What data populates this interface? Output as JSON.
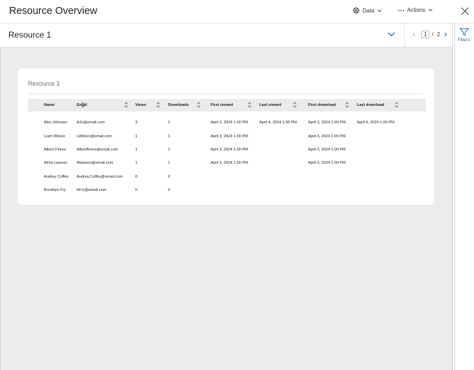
{
  "header": {
    "title": "Resource Overview",
    "data_label": "Data",
    "actions_label": "Actions"
  },
  "subbar": {
    "resource_name": "Resource 1",
    "pager": {
      "current": "1",
      "separator": "/",
      "total": "2"
    }
  },
  "rail": {
    "filters_label": "Filters"
  },
  "card": {
    "title": "Resource 1"
  },
  "table": {
    "columns": [
      "Name",
      "Email",
      "Views",
      "Downloads",
      "First viewed",
      "Last viewed",
      "First download",
      "Last download"
    ],
    "rows": [
      [
        "Alex Johnson",
        "AJs@email.com",
        "3",
        "1",
        "April 3, 2024 1:00 PM",
        "April 4, 2024 1:00 PM",
        "April 3, 2024 1:00 PM",
        "April 4, 2024 1:00 PM"
      ],
      [
        "Liam Wilson",
        "LWilson@email.com",
        "1",
        "1",
        "April 3, 2024 1:00 PM",
        "",
        "April 3, 2024 1:00 PM",
        ""
      ],
      [
        "Albert Flores",
        "Albertflores@email.com",
        "1",
        "1",
        "April 3, 2024 1:00 PM",
        "",
        "April 3, 2024 1:00 PM",
        ""
      ],
      [
        "Alma Lawson",
        "Alawson@email.com",
        "1",
        "1",
        "April 3, 2024 1:00 PM",
        "",
        "April 3, 2024 1:00 PM",
        ""
      ],
      [
        "Audrey Coffey",
        "Audrey.Coffey@email.com",
        "0",
        "0",
        "",
        "",
        "",
        ""
      ],
      [
        "Brooklyn Fry",
        "bFry@email.com",
        "0",
        "0",
        "",
        "",
        "",
        ""
      ]
    ]
  },
  "colors": {
    "accent": "#1e6fb3",
    "background": "#ececec",
    "header_row": "#ebebeb"
  },
  "icons": [
    "gear-icon",
    "chevron-down-icon",
    "ellipsis-icon",
    "close-icon",
    "chevron-left-icon",
    "chevron-right-icon",
    "filter-icon",
    "sort-icon"
  ]
}
